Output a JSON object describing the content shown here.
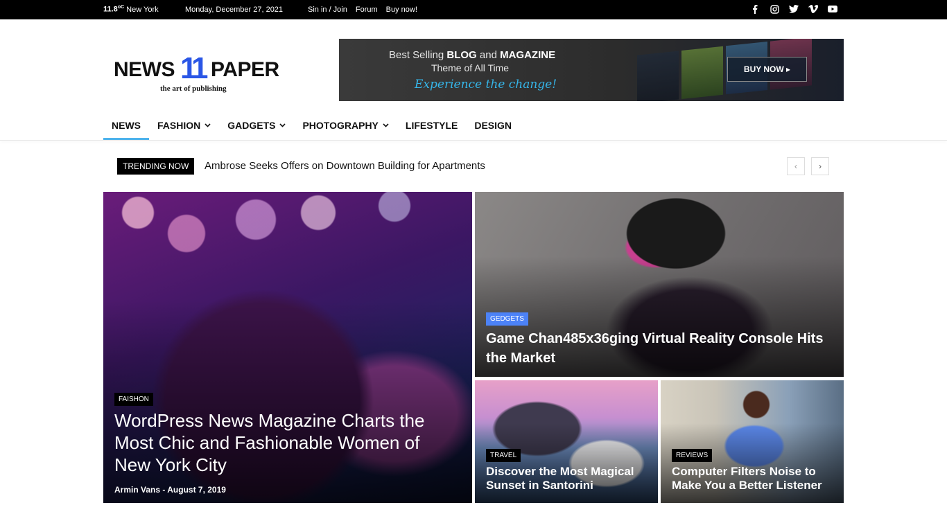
{
  "topbar": {
    "temp": "11.8",
    "unit": "oC",
    "city": "New York",
    "date": "Monday, December 27, 2021",
    "links": [
      "Sin in / Join",
      "Forum",
      "Buy now!"
    ],
    "social_icons": [
      "facebook-icon",
      "instagram-icon",
      "twitter-icon",
      "vimeo-icon",
      "youtube-icon"
    ]
  },
  "logo": {
    "word1": "NEWS",
    "number": "11",
    "word2": "PAPER",
    "tagline": "the art of publishing"
  },
  "banner": {
    "line1_pre": "Best Selling ",
    "line1_b1": "BLOG",
    "line1_mid": " and ",
    "line1_b2": "MAGAZINE",
    "line2": "Theme of All Time",
    "line3": "Experience the change!",
    "button": "BUY NOW ▸"
  },
  "nav": {
    "items": [
      {
        "label": "NEWS",
        "dropdown": false,
        "active": true
      },
      {
        "label": "FASHION",
        "dropdown": true
      },
      {
        "label": "GADGETS",
        "dropdown": true
      },
      {
        "label": "PHOTOGRAPHY",
        "dropdown": true
      },
      {
        "label": "LIFESTYLE",
        "dropdown": false
      },
      {
        "label": "DESIGN",
        "dropdown": false
      }
    ]
  },
  "trending": {
    "badge": "TRENDING NOW",
    "headline": "Ambrose Seeks Offers on Downtown Building for Apartments",
    "prev": "‹",
    "next": "›"
  },
  "posts": [
    {
      "category": "FAISHON",
      "title": "WordPress News Magazine Charts the Most Chic and Fashionable Women of New York City",
      "meta": "Armin Vans - August 7, 2019"
    },
    {
      "category": "GEDGETS",
      "title": "Game Chan485x36ging Virtual Reality Console Hits the Market",
      "category_color": "#4c82f7"
    },
    {
      "category": "TRAVEL",
      "title": "Discover the Most Magical Sunset in Santorini"
    },
    {
      "category": "REVIEWS",
      "title": "Computer Filters Noise to Make You a Better Listener"
    }
  ],
  "colors": {
    "accent": "#4db2ec",
    "logo_blue": "#2a56e6",
    "tag_blue": "#4c82f7"
  }
}
